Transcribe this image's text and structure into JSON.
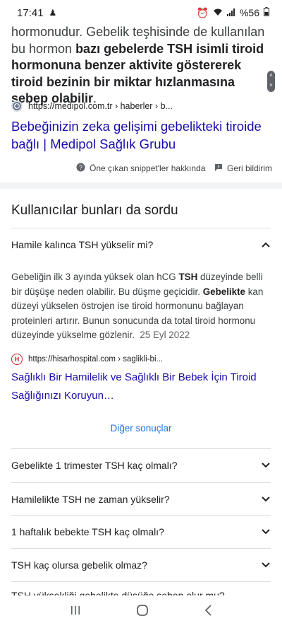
{
  "status": {
    "time": "17:41",
    "battery": "%56"
  },
  "snippet": {
    "p1": "hormonudur. Gebelik teşhisinde de kullanılan bu hormon ",
    "bold": "bazı gebelerde TSH isimli tiroid hormonuna benzer aktivite göstererek tiroid bezinin bir miktar hızlanmasına sebep olabilir",
    "end": "."
  },
  "result1": {
    "url": "https://medipol.com.tr › haberler › b...",
    "title": "Bebeğinizin zeka gelişimi gebelikteki tiroide bağlı | Medipol Sağlık Grubu"
  },
  "feedback": {
    "about": "Öne çıkan snippet'ler hakkında",
    "report": "Geri bildirim"
  },
  "paa": {
    "title": "Kullanıcılar bunları da sordu",
    "q1": "Hamile kalınca TSH yükselir mi?",
    "answer": {
      "a1": "Gebeliğin ilk 3 ayında yüksek olan hCG ",
      "b1": "TSH",
      "a2": " düzeyinde belli bir düşüşe neden olabilir. Bu düşme geçicidir. ",
      "b2": "Gebelikte",
      "a3": " kan düzeyi yükselen östrojen ise tiroid hormonunu bağlayan proteinleri artırır. Bunun sonucunda da total tiroid hormonu düzeyinde yükselme gözlenir.",
      "date": "25 Eyl 2022"
    },
    "source2_url": "https://hisarhospital.com › saglikli-bi...",
    "title2": "Sağlıklı Bir Hamilelik ve Sağlıklı Bir Bebek İçin Tiroid Sağlığınızı Koruyun…",
    "more": "Diğer sonuçlar",
    "questions": [
      "Gebelikte 1 trimester TSH kaç olmalı?",
      "Hamilelikte TSH ne zaman yükselir?",
      "1 haftalık bebekte TSH kaç olmalı?",
      "TSH kaç olursa gebelik olmaz?"
    ],
    "partial": "TSH yüksekliği gebelikte düşüğe sebep olur mu?"
  }
}
